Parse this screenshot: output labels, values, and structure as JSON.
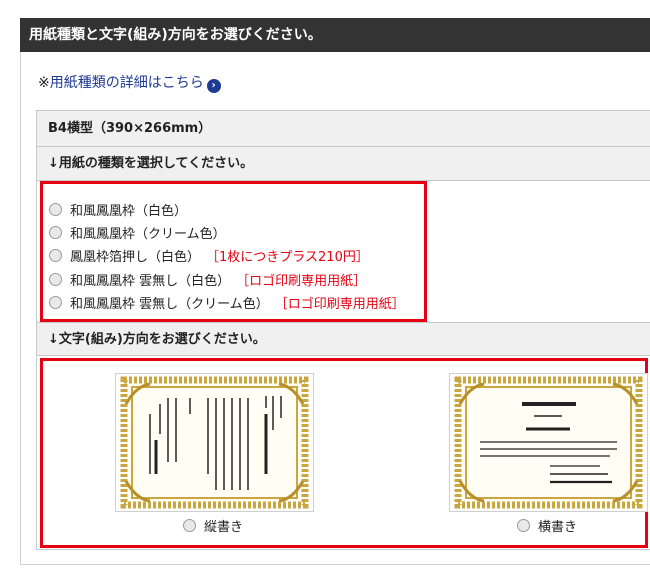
{
  "header": {
    "title": "用紙種類と文字(組み)方向をお選びください。"
  },
  "detail_link": {
    "mark": "※",
    "label": "用紙種類の詳細はこちら",
    "icon": "chevron-right-circle-icon"
  },
  "size": {
    "label": "B4横型（390×266mm）"
  },
  "paper_section": {
    "heading": "↓用紙の種類を選択してください。",
    "options": [
      {
        "label": "和風鳳凰枠（白色）",
        "note": ""
      },
      {
        "label": "和風鳳凰枠（クリーム色）",
        "note": ""
      },
      {
        "label": "鳳凰枠箔押し（白色）",
        "note": "［1枚につきプラス210円］"
      },
      {
        "label": "和風鳳凰枠 雲無し（白色）",
        "note": "［ロゴ印刷専用用紙］"
      },
      {
        "label": "和風鳳凰枠 雲無し（クリーム色）",
        "note": "［ロゴ印刷専用用紙］"
      }
    ]
  },
  "orientation_section": {
    "heading": "↓文字(組み)方向をお選びください。",
    "options": [
      {
        "label": "縦書き"
      },
      {
        "label": "横書き"
      }
    ]
  },
  "colors": {
    "header_bg": "#333333",
    "highlight_border": "#e60012",
    "link": "#1f3a93",
    "note": "#e60012",
    "frame_gold": "#c9a640"
  }
}
